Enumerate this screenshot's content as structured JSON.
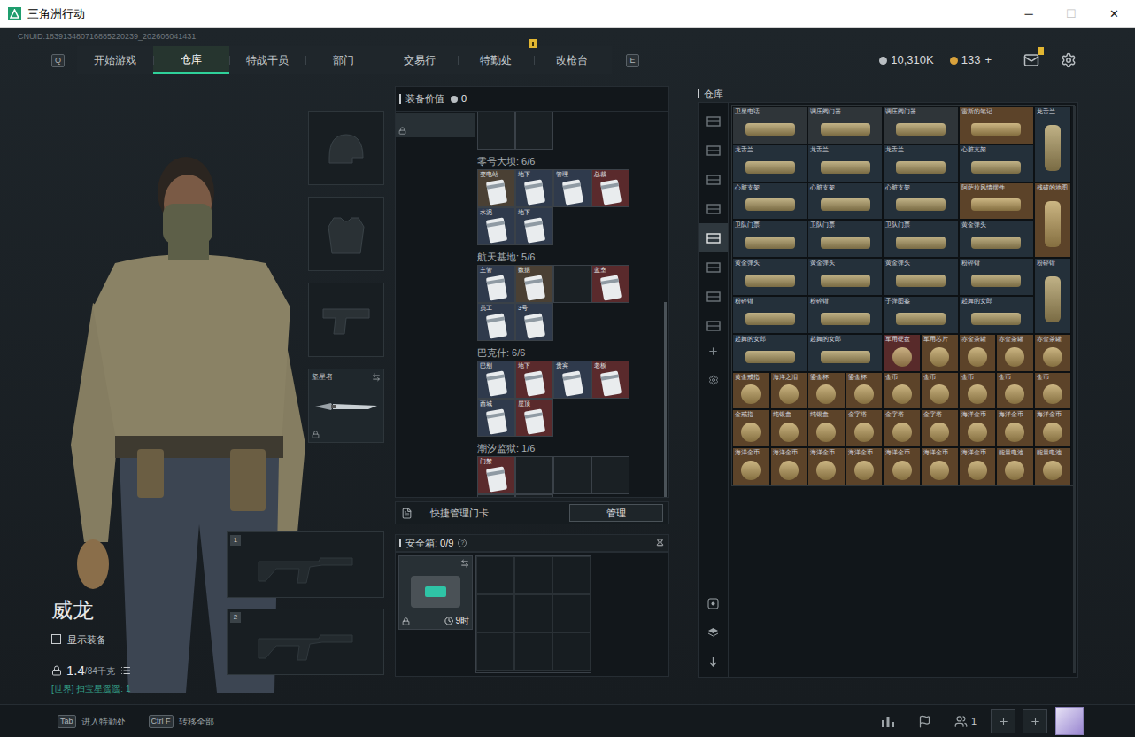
{
  "window": {
    "title": "三角洲行动",
    "controls": [
      {
        "glyph": "─",
        "disabled": false
      },
      {
        "glyph": "☐",
        "disabled": true
      },
      {
        "glyph": "✕",
        "disabled": false
      }
    ]
  },
  "uid": "CNUID:183913480716885220239_202606041431",
  "nav": {
    "left_key": "Q",
    "right_key": "E",
    "tabs": [
      {
        "label": "开始游戏",
        "selected": false,
        "badge": false
      },
      {
        "label": "仓库",
        "selected": true,
        "badge": false
      },
      {
        "label": "特战干员",
        "selected": false,
        "badge": false
      },
      {
        "label": "部门",
        "selected": false,
        "badge": false
      },
      {
        "label": "交易行",
        "selected": false,
        "badge": false
      },
      {
        "label": "特勤处",
        "selected": false,
        "badge": true
      },
      {
        "label": "改枪台",
        "selected": false,
        "badge": false
      }
    ]
  },
  "currencies": [
    {
      "value": "10,310K",
      "color": "#b9bec2",
      "plus": ""
    },
    {
      "value": "133",
      "color": "#d9a23c",
      "plus": "+"
    }
  ],
  "mail": {
    "badge": true
  },
  "character": {
    "name": "威龙",
    "show_equipment": {
      "label": "显示装备",
      "checked": false
    },
    "weight": "1.4",
    "capacity": "/84千克",
    "status": "[世界] 扫宝星遥遥: 1"
  },
  "equipment_slots": [
    {
      "kind": "helmet",
      "filled": false,
      "label": "",
      "locked": false
    },
    {
      "kind": "armor",
      "filled": false,
      "label": "",
      "locked": false
    },
    {
      "kind": "pistol",
      "filled": false,
      "label": "",
      "locked": false
    },
    {
      "kind": "melee",
      "filled": true,
      "label": "坚星者",
      "locked": true
    }
  ],
  "weapon_slots": [
    {
      "number": "1"
    },
    {
      "number": "2"
    }
  ],
  "loadout": {
    "value_label": "装备价值",
    "value": "0",
    "groups": [
      {
        "title": "零号大坝: 6/6",
        "slots": [
          {
            "filled": true,
            "label": "变电站",
            "color": "#4a4034"
          },
          {
            "filled": true,
            "label": "地下",
            "color": "#2f3a4c"
          },
          {
            "filled": true,
            "label": "管理",
            "color": "#2f3a4c"
          },
          {
            "filled": true,
            "label": "总裁",
            "color": "#5a2a2c"
          },
          {
            "filled": true,
            "label": "水泥",
            "color": "#2f3a4c"
          },
          {
            "filled": true,
            "label": "地下",
            "color": "#2f3a4c"
          }
        ]
      },
      {
        "title": "航天基地: 5/6",
        "slots": [
          {
            "filled": true,
            "label": "主管",
            "color": "#2f3a4c"
          },
          {
            "filled": true,
            "label": "数据",
            "color": "#4a4034"
          },
          {
            "filled": false,
            "label": "",
            "color": "#1a2024"
          },
          {
            "filled": true,
            "label": "蓝室",
            "color": "#5a2a2c"
          },
          {
            "filled": true,
            "label": "员工",
            "color": "#2f3a4c"
          },
          {
            "filled": true,
            "label": "3号",
            "color": "#2f3a4c"
          }
        ]
      },
      {
        "title": "巴克什: 6/6",
        "slots": [
          {
            "filled": true,
            "label": "巴别",
            "color": "#2f3a4c"
          },
          {
            "filled": true,
            "label": "地下",
            "color": "#5a2a2c"
          },
          {
            "filled": true,
            "label": "贵宾",
            "color": "#2f3a4c"
          },
          {
            "filled": true,
            "label": "老板",
            "color": "#5a2a2c"
          },
          {
            "filled": true,
            "label": "西城",
            "color": "#2f3a4c"
          },
          {
            "filled": true,
            "label": "屋顶",
            "color": "#5a2a2c"
          }
        ]
      },
      {
        "title": "潮汐监狱: 1/6",
        "slots": [
          {
            "filled": true,
            "label": "门禁",
            "color": "#5a2a2c"
          },
          {
            "filled": false,
            "label": "",
            "color": "#1a2024"
          },
          {
            "filled": false,
            "label": "",
            "color": "#1a2024"
          },
          {
            "filled": false,
            "label": "",
            "color": "#1a2024"
          },
          {
            "filled": false,
            "label": "",
            "color": "#1a2024"
          },
          {
            "filled": false,
            "label": "",
            "color": "#1a2024"
          }
        ]
      }
    ],
    "quick_manage": {
      "label": "快捷管理门卡",
      "button": "管理"
    }
  },
  "safebox": {
    "label": "安全箱:",
    "count": "0/9",
    "help": "?",
    "timer": "9时",
    "locked": true
  },
  "warehouse": {
    "title": "仓库",
    "tabs": [
      {
        "selected": false
      },
      {
        "selected": false
      },
      {
        "selected": false
      },
      {
        "selected": false
      },
      {
        "selected": true
      },
      {
        "selected": false
      },
      {
        "selected": false
      },
      {
        "selected": false
      }
    ],
    "items": [
      {
        "label": "卫星电话",
        "kind": "wide",
        "color": "#2f3539"
      },
      {
        "label": "调压阀门器",
        "kind": "wide",
        "color": "#2f3539"
      },
      {
        "label": "调压阀门器",
        "kind": "wide",
        "color": "#2f3539"
      },
      {
        "label": "雷斯的笔记",
        "kind": "wide",
        "color": "#5c4329"
      },
      {
        "label": "龙舌兰",
        "kind": "tall",
        "color": "#24303a"
      },
      {
        "label": "龙舌兰",
        "kind": "wide",
        "color": "#24303a"
      },
      {
        "label": "龙舌兰",
        "kind": "wide",
        "color": "#24303a"
      },
      {
        "label": "龙舌兰",
        "kind": "wide",
        "color": "#24303a"
      },
      {
        "label": "心脏支架",
        "kind": "wide",
        "color": "#24303a"
      },
      {
        "label": "心脏支架",
        "kind": "wide",
        "color": "#24303a"
      },
      {
        "label": "心脏支架",
        "kind": "wide",
        "color": "#24303a"
      },
      {
        "label": "心脏支架",
        "kind": "wide",
        "color": "#24303a"
      },
      {
        "label": "阿萨拉风情摆件",
        "kind": "wide",
        "color": "#5c4329"
      },
      {
        "label": "残破的地图",
        "kind": "tall",
        "color": "#5c4329"
      },
      {
        "label": "卫队门票",
        "kind": "wide",
        "color": "#24303a"
      },
      {
        "label": "卫队门票",
        "kind": "wide",
        "color": "#24303a"
      },
      {
        "label": "卫队门票",
        "kind": "wide",
        "color": "#24303a"
      },
      {
        "label": "黄金弹头",
        "kind": "wide",
        "color": "#24303a"
      },
      {
        "label": "黄金弹头",
        "kind": "wide",
        "color": "#24303a"
      },
      {
        "label": "黄金弹头",
        "kind": "wide",
        "color": "#24303a"
      },
      {
        "label": "黄金弹头",
        "kind": "wide",
        "color": "#24303a"
      },
      {
        "label": "粉碎钳",
        "kind": "wide",
        "color": "#24303a"
      },
      {
        "label": "粉碎钳",
        "kind": "tall",
        "color": "#24303a"
      },
      {
        "label": "粉碎钳",
        "kind": "wide",
        "color": "#24303a"
      },
      {
        "label": "粉碎钳",
        "kind": "wide",
        "color": "#24303a"
      },
      {
        "label": "子弹图鉴",
        "kind": "wide",
        "color": "#24303a"
      },
      {
        "label": "起舞的女郎",
        "kind": "wide",
        "color": "#24303a"
      },
      {
        "label": "起舞的女郎",
        "kind": "wide",
        "color": "#24303a"
      },
      {
        "label": "起舞的女郎",
        "kind": "wide",
        "color": "#24303a"
      },
      {
        "label": "军用硬盘",
        "kind": "cell",
        "color": "#582a2a"
      },
      {
        "label": "军用芯片",
        "kind": "cell",
        "color": "#5c4329"
      },
      {
        "label": "赤金茶罐",
        "kind": "cell",
        "color": "#5c4329"
      },
      {
        "label": "赤金茶罐",
        "kind": "cell",
        "color": "#5c4329"
      },
      {
        "label": "赤金茶罐",
        "kind": "cell",
        "color": "#5c4329"
      },
      {
        "label": "黄金戒指",
        "kind": "cell",
        "color": "#5c4329"
      },
      {
        "label": "海洋之泪",
        "kind": "cell",
        "color": "#5c4329"
      },
      {
        "label": "鎏金杯",
        "kind": "cell",
        "color": "#5c4329"
      },
      {
        "label": "鎏金杯",
        "kind": "cell",
        "color": "#5c4329"
      },
      {
        "label": "金币",
        "kind": "cell",
        "color": "#5c4329"
      },
      {
        "label": "金币",
        "kind": "cell",
        "color": "#5c4329"
      },
      {
        "label": "金币",
        "kind": "cell",
        "color": "#5c4329"
      },
      {
        "label": "金币",
        "kind": "cell",
        "color": "#5c4329"
      },
      {
        "label": "金币",
        "kind": "cell",
        "color": "#5c4329"
      },
      {
        "label": "金戒指",
        "kind": "cell",
        "color": "#5c4329"
      },
      {
        "label": "纯银盘",
        "kind": "cell",
        "color": "#5c4329"
      },
      {
        "label": "纯银盘",
        "kind": "cell",
        "color": "#5c4329"
      },
      {
        "label": "金字塔",
        "kind": "cell",
        "color": "#5c4329"
      },
      {
        "label": "金字塔",
        "kind": "cell",
        "color": "#5c4329"
      },
      {
        "label": "金字塔",
        "kind": "cell",
        "color": "#5c4329"
      },
      {
        "label": "海洋金币",
        "kind": "cell",
        "color": "#5c4329"
      },
      {
        "label": "海洋金币",
        "kind": "cell",
        "color": "#5c4329"
      },
      {
        "label": "海洋金币",
        "kind": "cell",
        "color": "#5c4329"
      },
      {
        "label": "海洋金币",
        "kind": "cell",
        "color": "#5c4329"
      },
      {
        "label": "海洋金币",
        "kind": "cell",
        "color": "#5c4329"
      },
      {
        "label": "海洋金币",
        "kind": "cell",
        "color": "#5c4329"
      },
      {
        "label": "海洋金币",
        "kind": "cell",
        "color": "#5c4329"
      },
      {
        "label": "海洋金币",
        "kind": "cell",
        "color": "#5c4329"
      },
      {
        "label": "海洋金币",
        "kind": "cell",
        "color": "#5c4329"
      },
      {
        "label": "海洋金币",
        "kind": "cell",
        "color": "#5c4329"
      },
      {
        "label": "能量电池",
        "kind": "cell",
        "color": "#5c4329"
      },
      {
        "label": "能量电池",
        "kind": "cell",
        "color": "#5c4329"
      }
    ]
  },
  "bottom_bar": {
    "hints": [
      {
        "key": "Tab",
        "label": "进入特勤处"
      },
      {
        "key": "Ctrl F",
        "label": "转移全部"
      }
    ],
    "party_count": "1"
  }
}
